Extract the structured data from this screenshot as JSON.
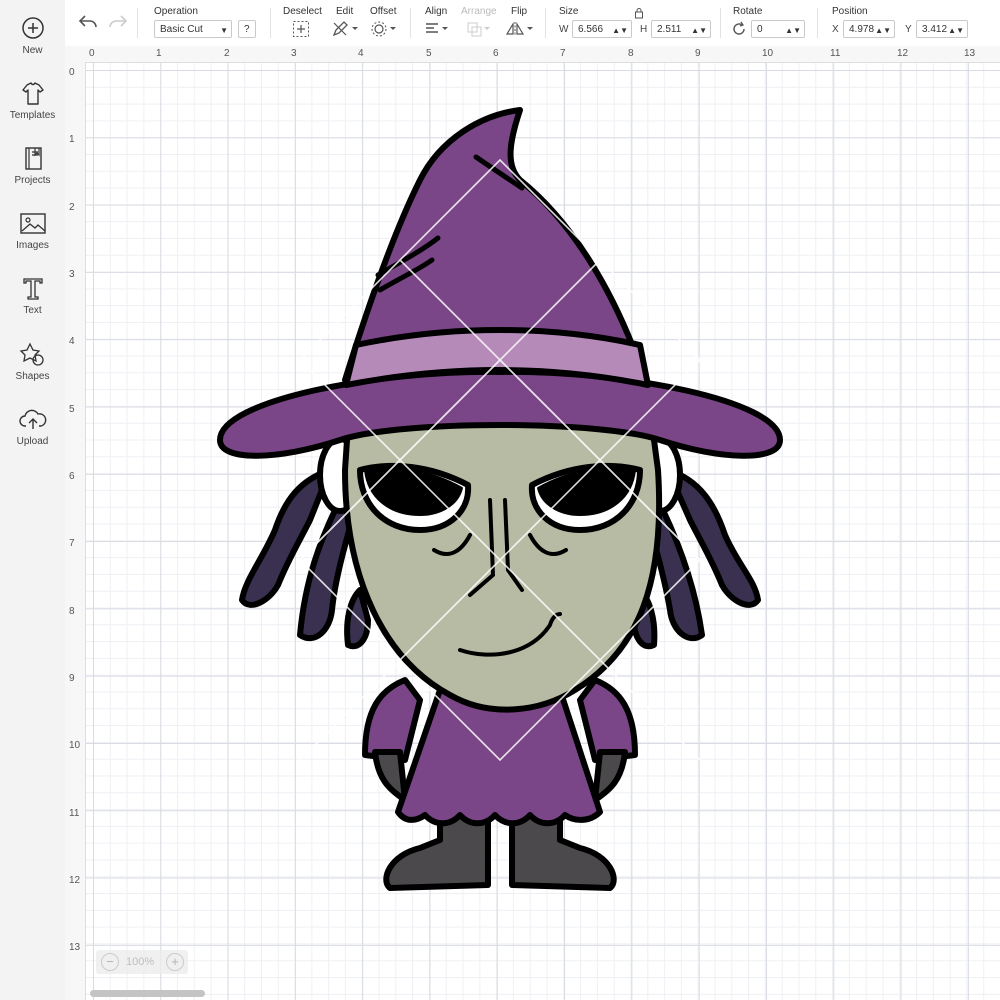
{
  "sidebar": {
    "items": [
      {
        "label": "New",
        "icon": "plus-circle-icon"
      },
      {
        "label": "Templates",
        "icon": "tshirt-icon"
      },
      {
        "label": "Projects",
        "icon": "notebook-icon"
      },
      {
        "label": "Images",
        "icon": "image-icon"
      },
      {
        "label": "Text",
        "icon": "text-t-icon"
      },
      {
        "label": "Shapes",
        "icon": "shapes-icon"
      },
      {
        "label": "Upload",
        "icon": "cloud-upload-icon"
      }
    ]
  },
  "toolbar": {
    "operation_label": "Operation",
    "operation_value": "Basic Cut",
    "help_label": "?",
    "deselect_label": "Deselect",
    "edit_label": "Edit",
    "offset_label": "Offset",
    "align_label": "Align",
    "arrange_label": "Arrange",
    "flip_label": "Flip",
    "size_label": "Size",
    "width_axis": "W",
    "width_value": "6.566",
    "height_axis": "H",
    "height_value": "2.511",
    "rotate_label": "Rotate",
    "rotate_value": "0",
    "position_label": "Position",
    "x_axis": "X",
    "x_value": "4.978",
    "y_axis": "Y",
    "y_value": "3.412"
  },
  "ruler": {
    "top": [
      "0",
      "1",
      "2",
      "3",
      "4",
      "5",
      "6",
      "7",
      "8",
      "9",
      "10",
      "11",
      "12",
      "13"
    ],
    "left": [
      "0",
      "1",
      "2",
      "3",
      "4",
      "5",
      "6",
      "7",
      "8",
      "9",
      "10",
      "11",
      "12",
      "13"
    ]
  },
  "zoom": {
    "minus": "−",
    "value": "100%",
    "plus": "+"
  },
  "colors": {
    "hat": "#7a4687",
    "band": "#b58ab9",
    "face": "#b7bba3",
    "hair": "#3a3150",
    "boots": "#4b494c",
    "outline": "#000000"
  }
}
